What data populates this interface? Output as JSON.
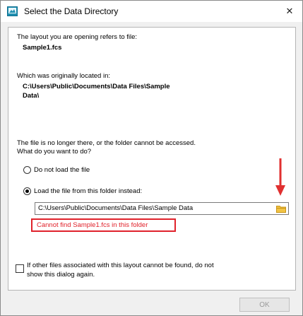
{
  "window": {
    "title": "Select the Data Directory",
    "close_glyph": "✕"
  },
  "content": {
    "intro_text": "The layout you are opening refers to file:",
    "file_name": "Sample1.fcs",
    "original_location_label": "Which was originally located in:",
    "original_path_line1": "C:\\Users\\Public\\Documents\\Data Files\\Sample",
    "original_path_line2": "Data\\",
    "missing_line1": "The file is no longer there, or the folder cannot be accessed.",
    "missing_line2": "What do you want to do?"
  },
  "options": {
    "do_not_load_label": "Do not load the file",
    "load_from_folder_label": "Load the file from this folder instead:",
    "selected": "load_from_folder"
  },
  "folder_field": {
    "value": "C:\\Users\\Public\\Documents\\Data Files\\Sample Data"
  },
  "error": {
    "message": "Cannot find Sample1.fcs in this folder"
  },
  "checkbox": {
    "label_line1": "If other files associated with this layout cannot be found, do not",
    "label_line2": "show this dialog again.",
    "checked": false
  },
  "buttons": {
    "ok_label": "OK"
  },
  "colors": {
    "error_red": "#e0222b",
    "arrow_red": "#e03030",
    "folder_yellow": "#e8b020"
  }
}
